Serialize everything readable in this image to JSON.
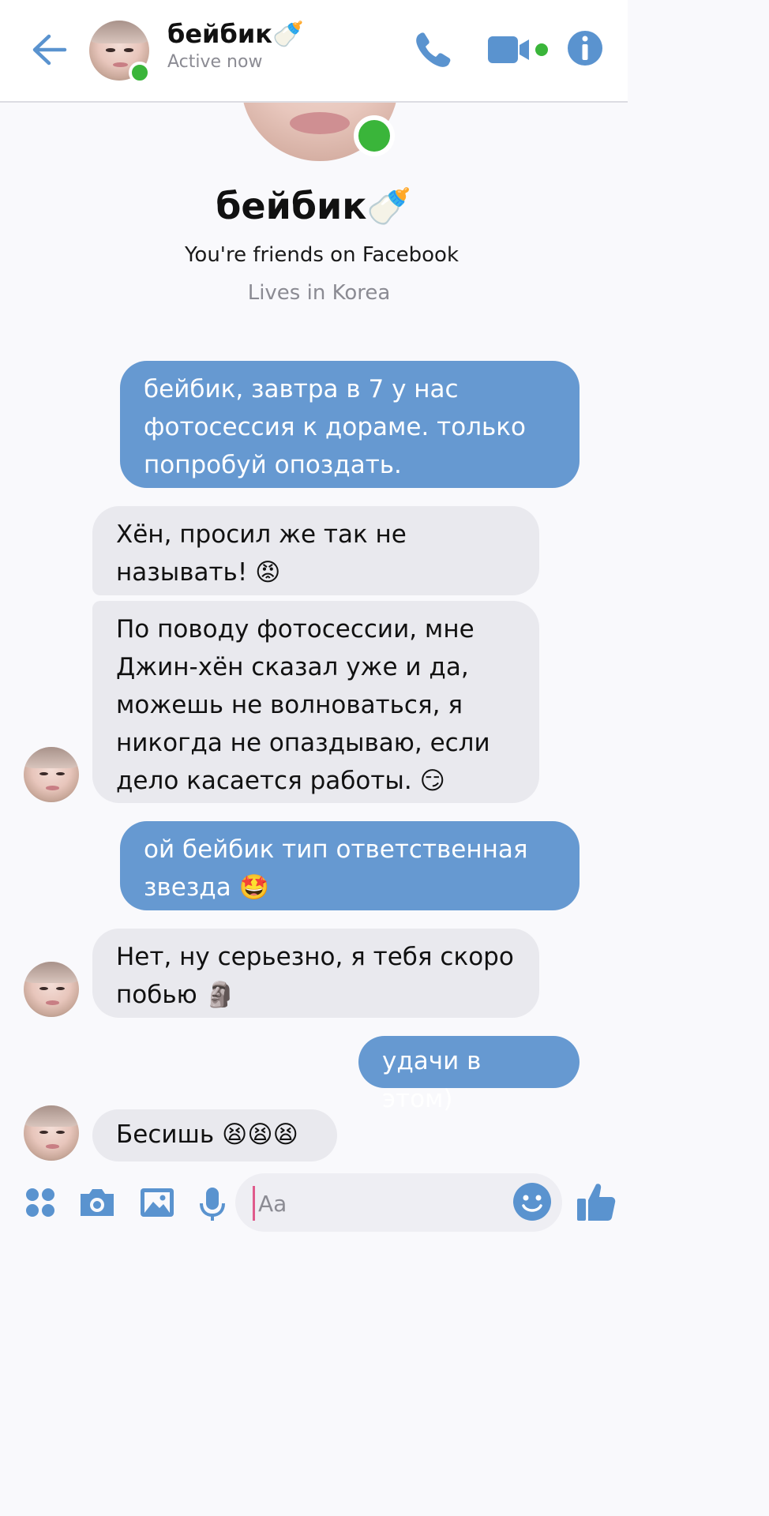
{
  "header": {
    "contact_name": "бейбик🍼",
    "status": "Active now"
  },
  "profile": {
    "name": "бейбик🍼",
    "friends_text": "You're friends on Facebook",
    "location": "Lives in Korea"
  },
  "messages": [
    {
      "direction": "outgoing",
      "text": "бейбик, завтра в 7 у нас фотосессия к дораме. только попробуй опоздать."
    },
    {
      "direction": "incoming",
      "text": "Хён, просил же так не называть! 😡"
    },
    {
      "direction": "incoming",
      "text": "По поводу фотосессии, мне Джин-хён сказал уже и да, можешь не волноваться, я никогда не опаздываю, если дело касается работы. 😏"
    },
    {
      "direction": "outgoing",
      "text": "ой бейбик тип ответственная звезда 🤩"
    },
    {
      "direction": "incoming",
      "text": "Нет, ну серьезно, я тебя скоро побью 🗿"
    },
    {
      "direction": "outgoing",
      "text": "удачи в этом)"
    },
    {
      "direction": "incoming",
      "text": "Бесишь 😫😫😫"
    }
  ],
  "composer": {
    "placeholder": "Aa"
  },
  "colors": {
    "accent": "#6699d1",
    "online": "#3ab53a",
    "incoming_bubble": "#e9e9ee",
    "outgoing_bubble": "#6699d1"
  },
  "icons": [
    "back-arrow-icon",
    "phone-icon",
    "video-camera-icon",
    "info-icon",
    "apps-icon",
    "camera-icon",
    "gallery-icon",
    "microphone-icon",
    "emoji-icon",
    "thumbs-up-icon"
  ]
}
